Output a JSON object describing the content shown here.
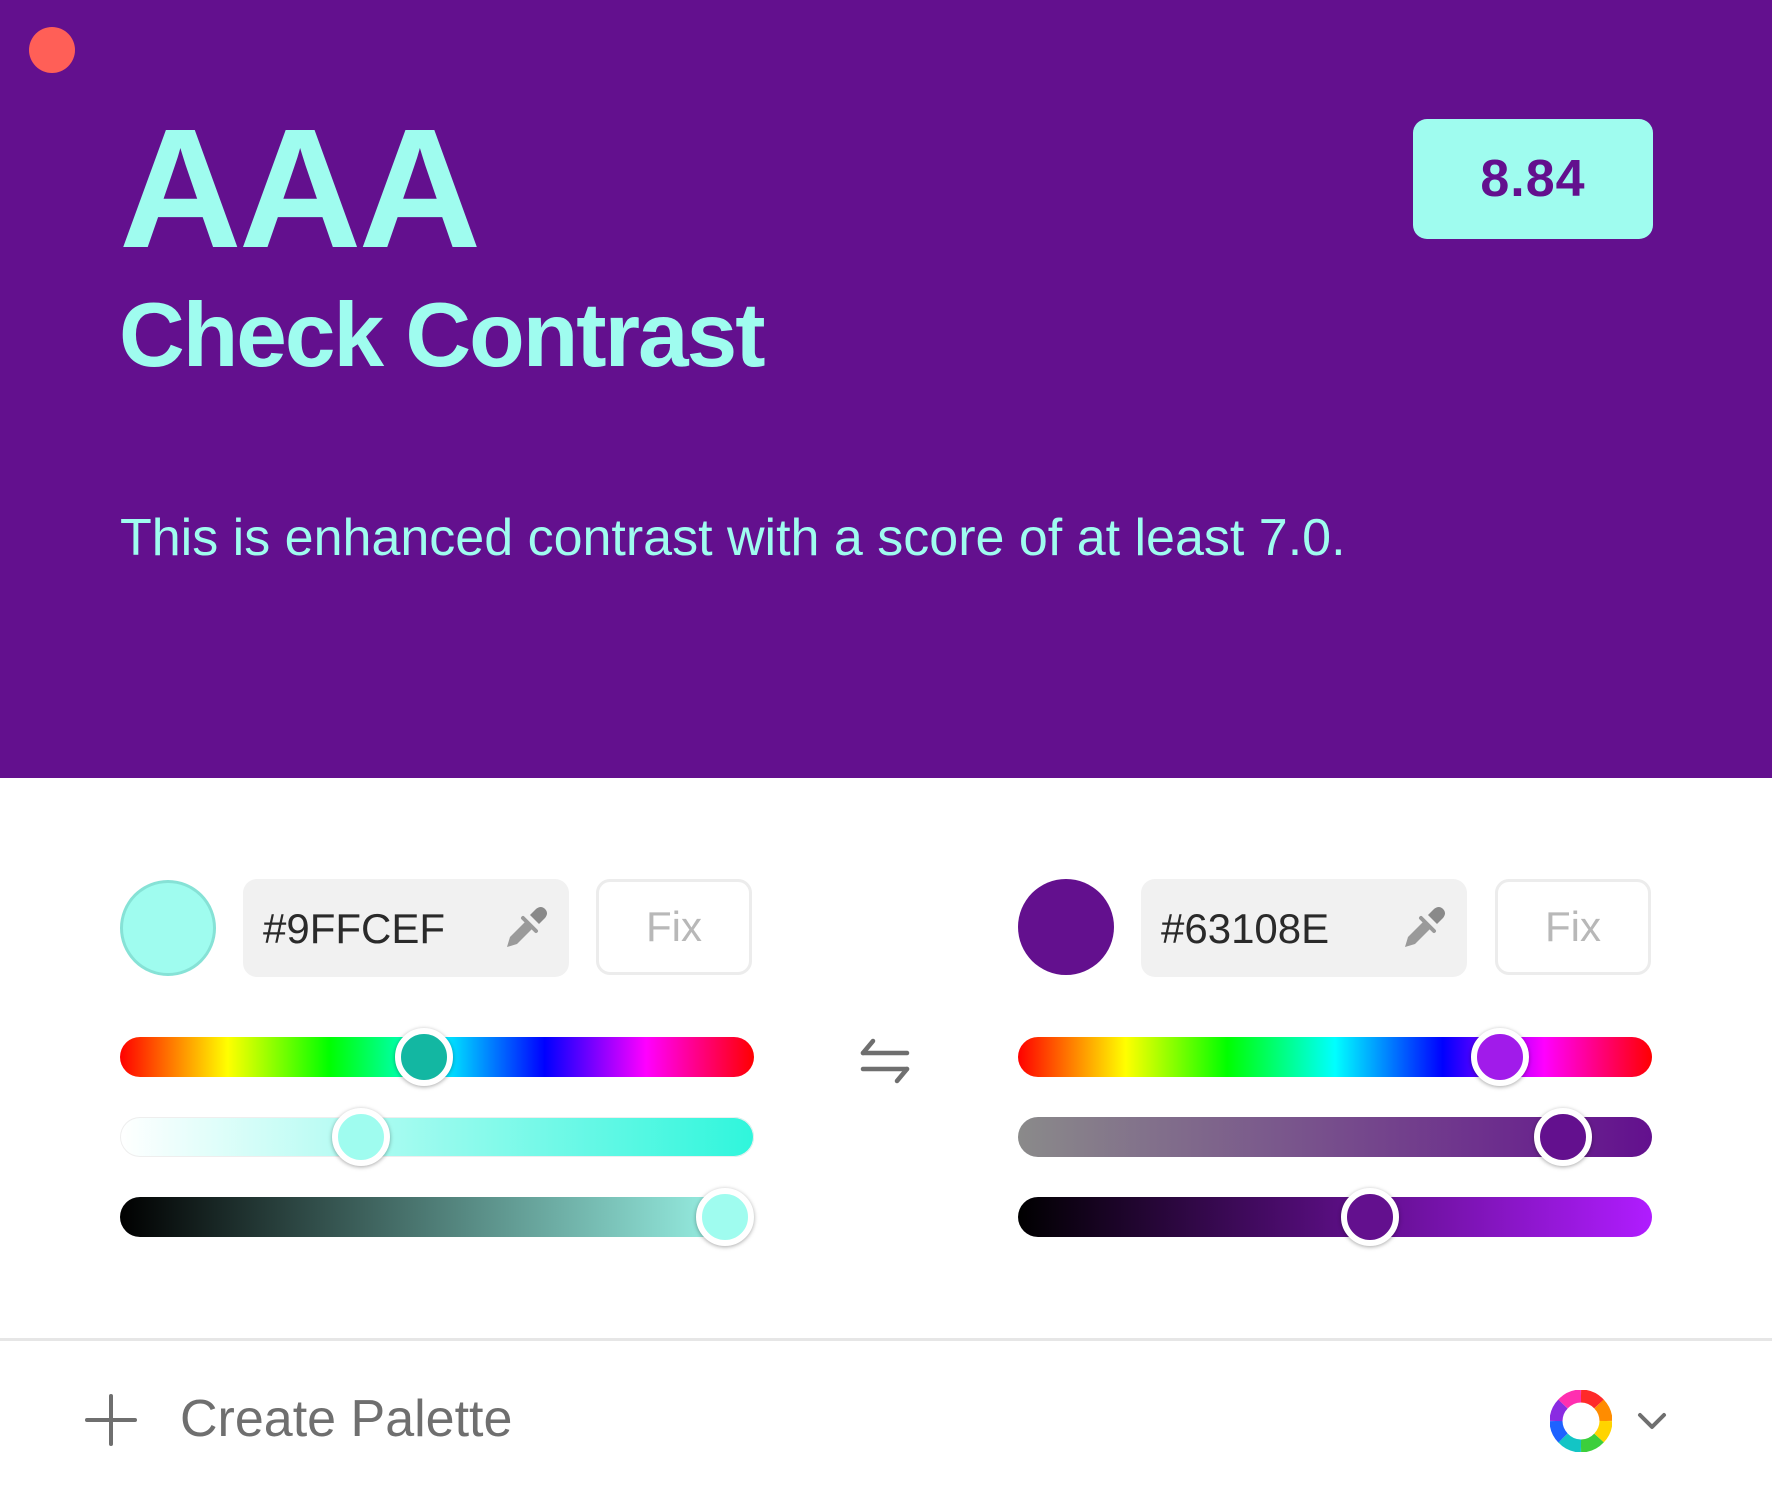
{
  "preview": {
    "grade": "AAA",
    "subtitle": "Check Contrast",
    "score": "8.84",
    "description": "This is enhanced contrast with a score of at least 7.0.",
    "background_color": "#63108E",
    "text_color": "#9FFCEF",
    "close_button_color": "#FF5F57",
    "close_icon": "close-dot-icon"
  },
  "foreground": {
    "hex": "#9FFCEF",
    "swatch_color": "#9FFCEF",
    "pipette_icon": "eyedropper-icon",
    "fix_label": "Fix",
    "hue_level": 0.48,
    "saturation_level": 0.38,
    "brightness_level": 0.955,
    "hue_thumb_color": "#13B7A2",
    "saturation_thumb_color": "#9FFCEF",
    "brightness_thumb_color": "#9FFCEF"
  },
  "background": {
    "hex": "#63108E",
    "swatch_color": "#63108E",
    "pipette_icon": "eyedropper-icon",
    "fix_label": "Fix",
    "hue_level": 0.76,
    "saturation_level": 0.86,
    "brightness_level": 0.555,
    "hue_thumb_color": "#A11BEA",
    "saturation_thumb_color": "#63108E",
    "brightness_thumb_color": "#63108E"
  },
  "swap_icon": "swap-arrows-icon",
  "footer": {
    "create_label": "Create Palette",
    "plus_icon": "plus-icon",
    "wheel_icon": "color-wheel-icon",
    "chevron_icon": "chevron-down-icon"
  }
}
